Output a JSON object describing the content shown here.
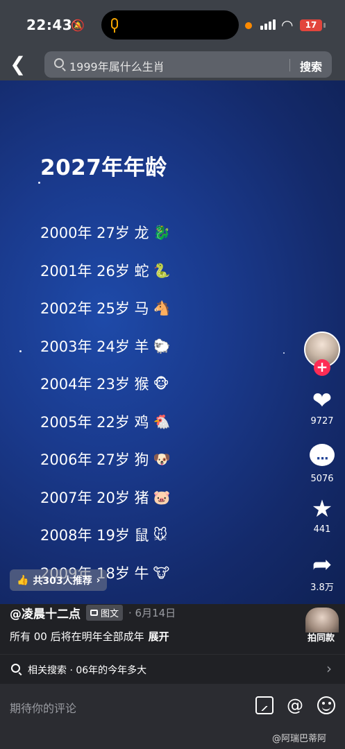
{
  "status_bar": {
    "time": "22:43",
    "battery": "17"
  },
  "header": {
    "search_query": "1999年属什么生肖",
    "search_button": "搜索"
  },
  "post": {
    "title": "2027年年龄",
    "ages": [
      {
        "text": "2000年 27岁 龙",
        "emoji": "🐉"
      },
      {
        "text": "2001年 26岁 蛇",
        "emoji": "🐍"
      },
      {
        "text": "2002年 25岁 马",
        "emoji": "🐴"
      },
      {
        "text": "2003年 24岁 羊",
        "emoji": "🐑"
      },
      {
        "text": "2004年 23岁 猴",
        "emoji": "🐵"
      },
      {
        "text": "2005年 22岁 鸡",
        "emoji": "🐔"
      },
      {
        "text": "2006年 27岁 狗",
        "emoji": "🐶"
      },
      {
        "text": "2007年 20岁 猪",
        "emoji": "🐷"
      },
      {
        "text": "2008年 19岁 鼠",
        "emoji": "🐭"
      },
      {
        "text": "2009年 18岁 牛",
        "emoji": "🐮"
      }
    ],
    "recommend": "共303人推荐",
    "author": "@凌晨十二点",
    "type_tag": "图文",
    "date": "· 6月14日",
    "description": "所有 00 后将在明年全部成年",
    "expand": "展开",
    "same_style": "拍同款"
  },
  "actions": {
    "likes": "9727",
    "comments": "5076",
    "favorites": "441",
    "shares": "3.8万"
  },
  "related_search": "相关搜索 · 06年的今年多大",
  "comment_bar": {
    "placeholder": "期待你的评论"
  },
  "watermark": "@阿瑞巴蒂阿"
}
